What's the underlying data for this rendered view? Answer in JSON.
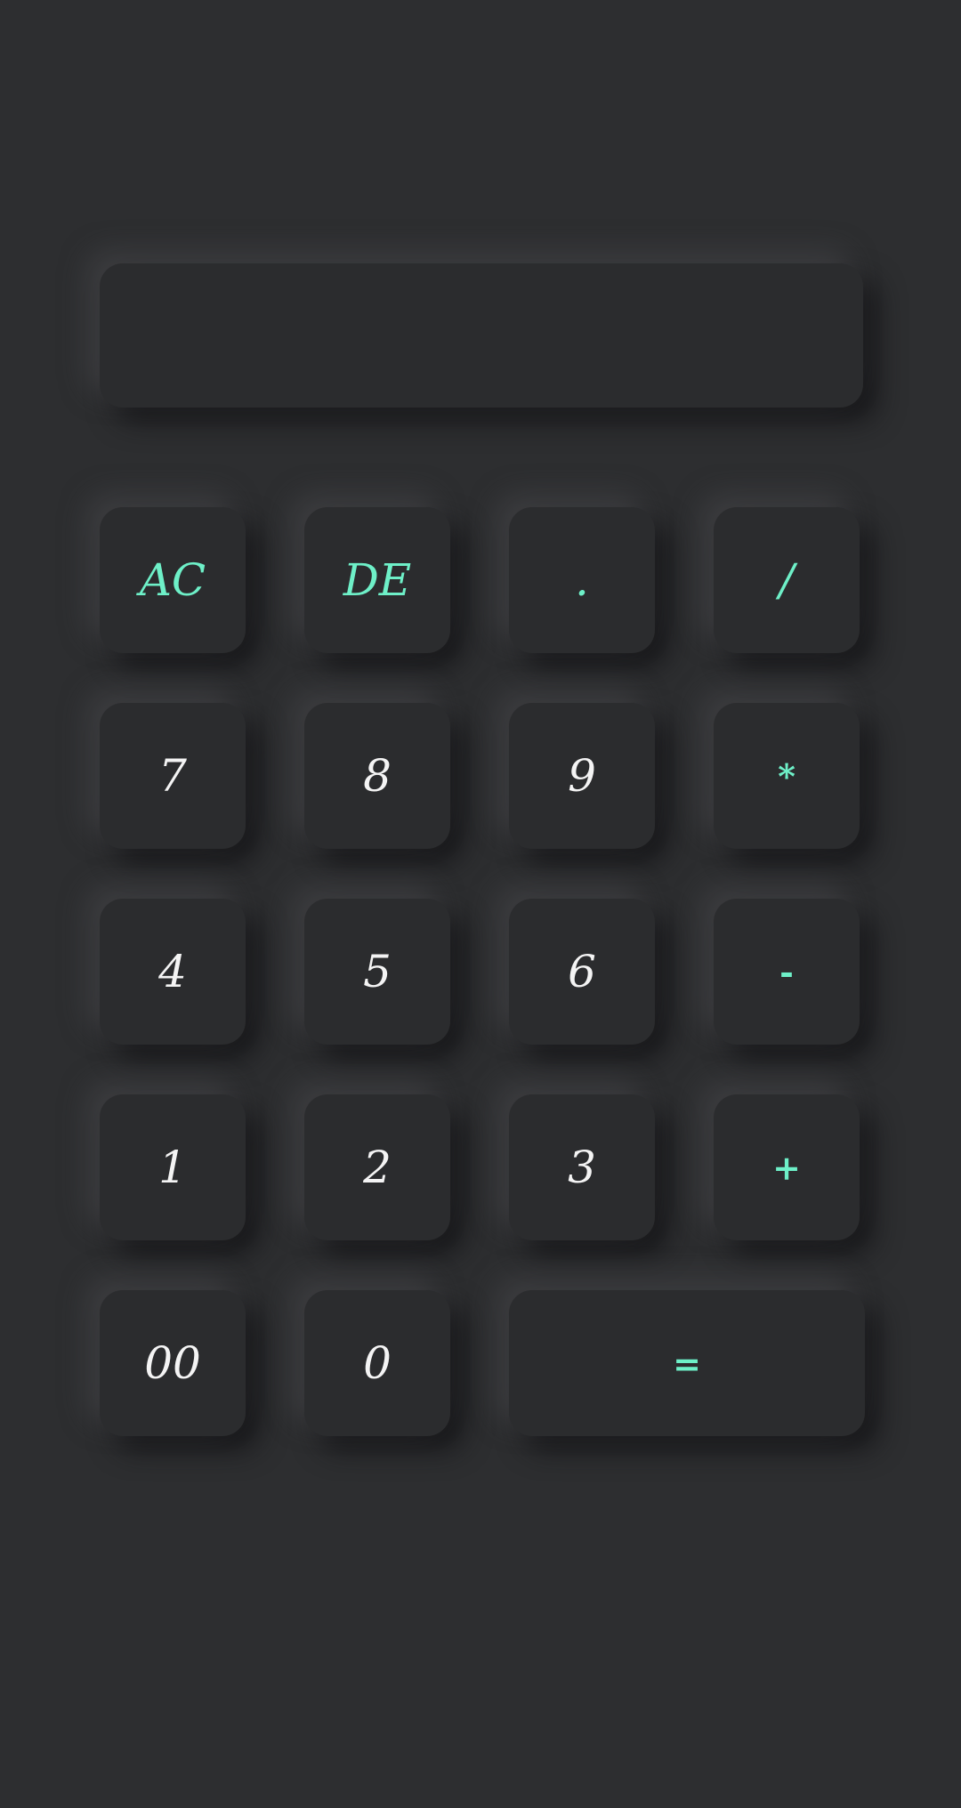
{
  "display": {
    "value": ""
  },
  "keys": {
    "all_clear": "AC",
    "delete": "DE",
    "decimal": ".",
    "divide": "/",
    "seven": "7",
    "eight": "8",
    "nine": "9",
    "multiply": "*",
    "four": "4",
    "five": "5",
    "six": "6",
    "subtract": "-",
    "one": "1",
    "two": "2",
    "three": "3",
    "add": "+",
    "double_zero": "00",
    "zero": "0",
    "equals": "="
  },
  "colors": {
    "background": "#2d2e30",
    "key_surface": "#2b2c2e",
    "accent": "#6ef0c8",
    "digit_text": "#f4f4f4"
  }
}
